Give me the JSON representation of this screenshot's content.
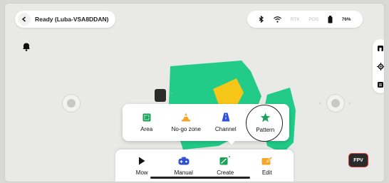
{
  "status": {
    "text": "Ready  (Luba-VSA8DDAN)"
  },
  "system_bar": {
    "rtk_label": "RTK",
    "pos_label": "POS",
    "battery_text": "76%"
  },
  "create_menu": {
    "items": [
      {
        "label": "Area",
        "icon": "area-icon"
      },
      {
        "label": "No-go zone",
        "icon": "cone-icon"
      },
      {
        "label": "Channel",
        "icon": "road-icon"
      },
      {
        "label": "Pattern",
        "icon": "star-icon"
      }
    ]
  },
  "bottom_nav": {
    "items": [
      {
        "label": "Mow",
        "icon": "play-icon"
      },
      {
        "label": "Manual",
        "icon": "gamepad-icon"
      },
      {
        "label": "Create",
        "icon": "create-icon"
      },
      {
        "label": "Edit",
        "icon": "pencil-icon"
      }
    ]
  },
  "fpv": {
    "label": "FPV"
  },
  "colors": {
    "green": "#22cc88",
    "yellow": "#f5c518",
    "accent_blue": "#2f4fd6",
    "orange": "#f5a623"
  }
}
